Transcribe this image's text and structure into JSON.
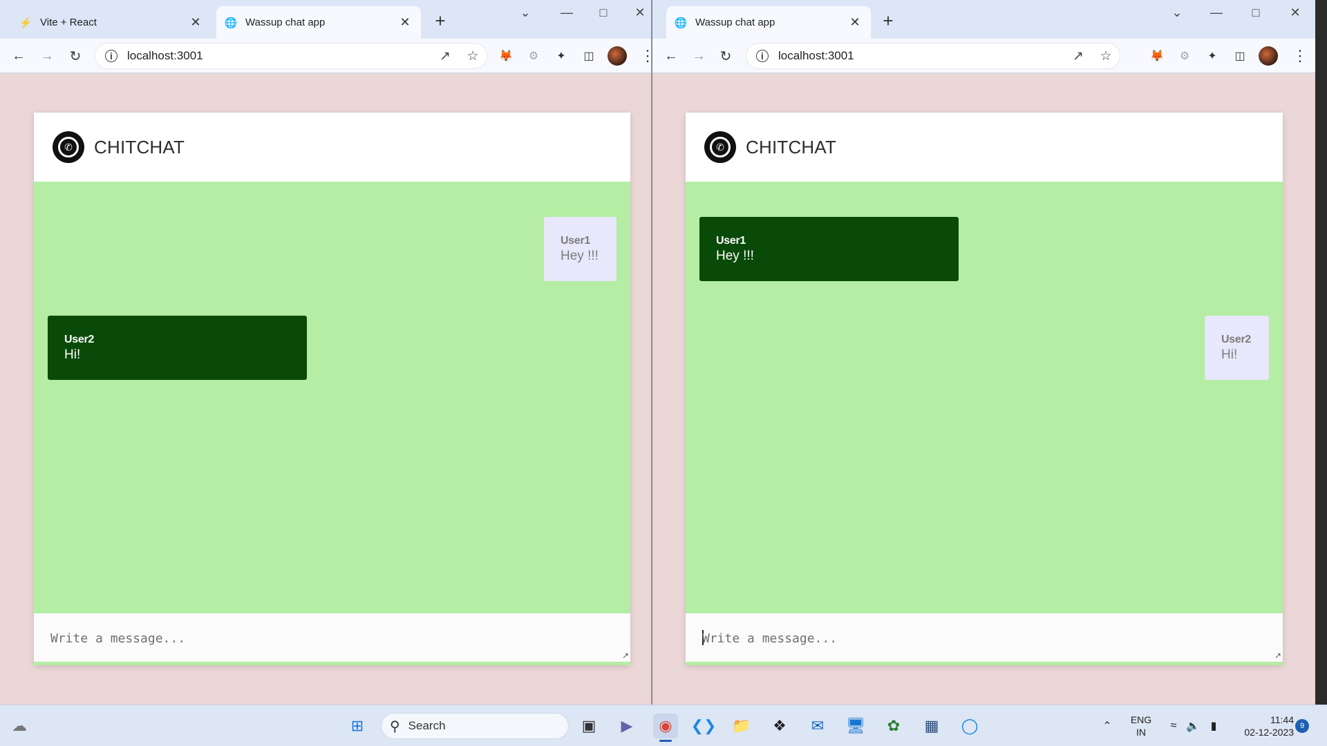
{
  "left_window": {
    "tabs": [
      {
        "label": "Vite + React",
        "favicon": "vite-icon"
      },
      {
        "label": "Wassup chat app",
        "favicon": "globe-icon"
      }
    ],
    "url": "localhost:3001",
    "chat": {
      "brand": "CHITCHAT",
      "messages": [
        {
          "user": "User1",
          "text": "Hey !!!",
          "side": "right",
          "style": "light"
        },
        {
          "user": "User2",
          "text": "Hi!",
          "side": "left",
          "style": "dark"
        }
      ],
      "input_placeholder": "Write a message..."
    }
  },
  "right_window": {
    "tabs": [
      {
        "label": "Wassup chat app",
        "favicon": "globe-icon"
      }
    ],
    "url": "localhost:3001",
    "chat": {
      "brand": "CHITCHAT",
      "messages": [
        {
          "user": "User1",
          "text": "Hey !!!",
          "side": "left",
          "style": "dark"
        },
        {
          "user": "User2",
          "text": "Hi!",
          "side": "right",
          "style": "light"
        }
      ],
      "input_placeholder": "Write a message..."
    }
  },
  "taskbar": {
    "search_placeholder": "Search",
    "lang_line1": "ENG",
    "lang_line2": "IN",
    "time": "11:44",
    "date": "02-12-2023",
    "notification_count": "9"
  },
  "colors": {
    "page_bg": "#ebd7d7",
    "chat_bg": "#b4eda3",
    "dark_bubble": "#0a4a09",
    "light_bubble": "#e8e7fb"
  }
}
